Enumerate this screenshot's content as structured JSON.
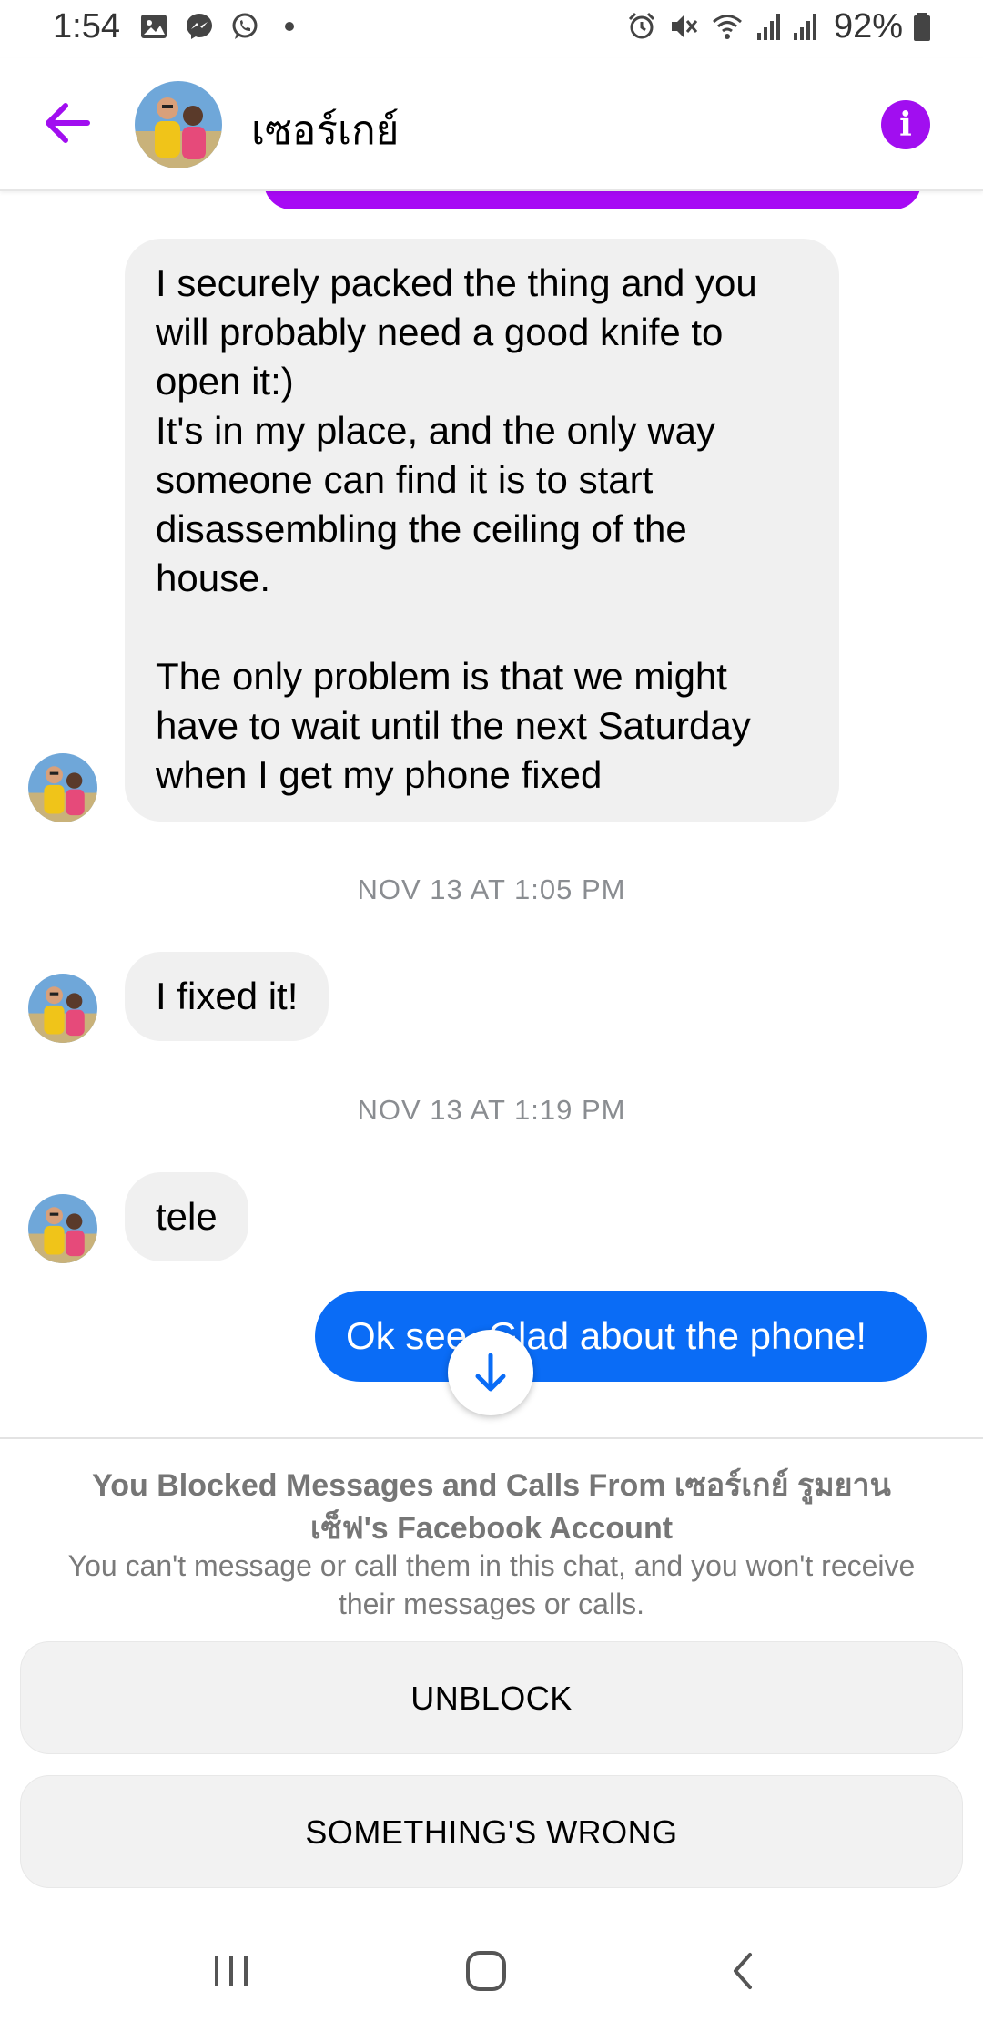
{
  "status_bar": {
    "time": "1:54",
    "battery": "92%",
    "icons": [
      "gallery-icon",
      "messenger-icon",
      "whatsapp-icon",
      "dot-icon",
      "alarm-icon",
      "mute-icon",
      "wifi-icon",
      "signal-icon",
      "signal-icon",
      "battery-icon"
    ]
  },
  "header": {
    "contact_name": "เซอร์เกย์",
    "back_icon": "arrow-left-icon",
    "info_icon": "info-icon",
    "accent_color": "#a10ef0"
  },
  "messages": {
    "long_message_lines": [
      "I securely packed the thing and you",
      "will probably need a good knife to",
      "open it:)",
      "It's in my place, and the only way",
      "someone can find it is to start",
      "disassembling the ceiling of the",
      "house.",
      "",
      "The only problem is that we might",
      "have to wait until the next Saturday",
      "when I get my phone fixed"
    ],
    "timestamp_1": "NOV 13 AT 1:05 PM",
    "fixed_message": "I fixed it!",
    "timestamp_2": "NOV 13 AT 1:19 PM",
    "tele_message": "tele",
    "outgoing_message": "Ok see. Glad about the phone!",
    "outgoing_color": "#0a6cf6",
    "incoming_color": "#f0f0f0"
  },
  "blocked": {
    "title": "You Blocked Messages and Calls From เซอร์เกย์ รูมยาน เซ็ฟ's Facebook Account",
    "subtitle": "You can't message or call them in this chat, and you won't receive their messages or calls.",
    "unblock_label": "UNBLOCK",
    "wrong_label": "SOMETHING'S WRONG"
  },
  "nav_bar": {
    "icons": [
      "recent-apps-icon",
      "home-icon",
      "back-icon"
    ]
  }
}
